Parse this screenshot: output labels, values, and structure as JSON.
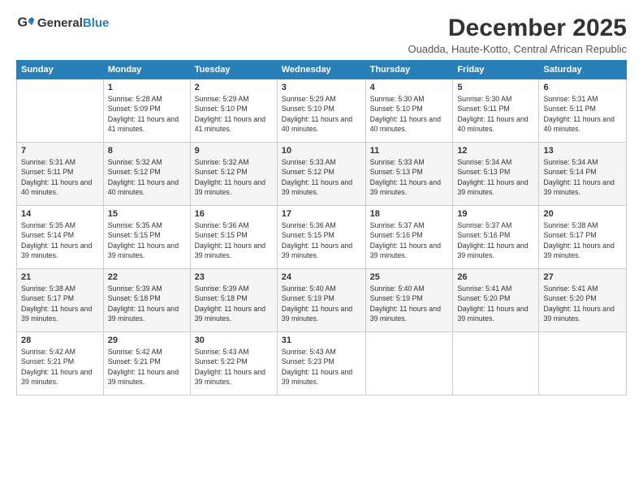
{
  "logo": {
    "general": "General",
    "blue": "Blue"
  },
  "title": "December 2025",
  "location": "Ouadda, Haute-Kotto, Central African Republic",
  "weekdays": [
    "Sunday",
    "Monday",
    "Tuesday",
    "Wednesday",
    "Thursday",
    "Friday",
    "Saturday"
  ],
  "weeks": [
    [
      {
        "day": "",
        "sunrise": "",
        "sunset": "",
        "daylight": ""
      },
      {
        "day": "1",
        "sunrise": "Sunrise: 5:28 AM",
        "sunset": "Sunset: 5:09 PM",
        "daylight": "Daylight: 11 hours and 41 minutes."
      },
      {
        "day": "2",
        "sunrise": "Sunrise: 5:29 AM",
        "sunset": "Sunset: 5:10 PM",
        "daylight": "Daylight: 11 hours and 41 minutes."
      },
      {
        "day": "3",
        "sunrise": "Sunrise: 5:29 AM",
        "sunset": "Sunset: 5:10 PM",
        "daylight": "Daylight: 11 hours and 40 minutes."
      },
      {
        "day": "4",
        "sunrise": "Sunrise: 5:30 AM",
        "sunset": "Sunset: 5:10 PM",
        "daylight": "Daylight: 11 hours and 40 minutes."
      },
      {
        "day": "5",
        "sunrise": "Sunrise: 5:30 AM",
        "sunset": "Sunset: 5:11 PM",
        "daylight": "Daylight: 11 hours and 40 minutes."
      },
      {
        "day": "6",
        "sunrise": "Sunrise: 5:31 AM",
        "sunset": "Sunset: 5:11 PM",
        "daylight": "Daylight: 11 hours and 40 minutes."
      }
    ],
    [
      {
        "day": "7",
        "sunrise": "Sunrise: 5:31 AM",
        "sunset": "Sunset: 5:11 PM",
        "daylight": "Daylight: 11 hours and 40 minutes."
      },
      {
        "day": "8",
        "sunrise": "Sunrise: 5:32 AM",
        "sunset": "Sunset: 5:12 PM",
        "daylight": "Daylight: 11 hours and 40 minutes."
      },
      {
        "day": "9",
        "sunrise": "Sunrise: 5:32 AM",
        "sunset": "Sunset: 5:12 PM",
        "daylight": "Daylight: 11 hours and 39 minutes."
      },
      {
        "day": "10",
        "sunrise": "Sunrise: 5:33 AM",
        "sunset": "Sunset: 5:12 PM",
        "daylight": "Daylight: 11 hours and 39 minutes."
      },
      {
        "day": "11",
        "sunrise": "Sunrise: 5:33 AM",
        "sunset": "Sunset: 5:13 PM",
        "daylight": "Daylight: 11 hours and 39 minutes."
      },
      {
        "day": "12",
        "sunrise": "Sunrise: 5:34 AM",
        "sunset": "Sunset: 5:13 PM",
        "daylight": "Daylight: 11 hours and 39 minutes."
      },
      {
        "day": "13",
        "sunrise": "Sunrise: 5:34 AM",
        "sunset": "Sunset: 5:14 PM",
        "daylight": "Daylight: 11 hours and 39 minutes."
      }
    ],
    [
      {
        "day": "14",
        "sunrise": "Sunrise: 5:35 AM",
        "sunset": "Sunset: 5:14 PM",
        "daylight": "Daylight: 11 hours and 39 minutes."
      },
      {
        "day": "15",
        "sunrise": "Sunrise: 5:35 AM",
        "sunset": "Sunset: 5:15 PM",
        "daylight": "Daylight: 11 hours and 39 minutes."
      },
      {
        "day": "16",
        "sunrise": "Sunrise: 5:36 AM",
        "sunset": "Sunset: 5:15 PM",
        "daylight": "Daylight: 11 hours and 39 minutes."
      },
      {
        "day": "17",
        "sunrise": "Sunrise: 5:36 AM",
        "sunset": "Sunset: 5:15 PM",
        "daylight": "Daylight: 11 hours and 39 minutes."
      },
      {
        "day": "18",
        "sunrise": "Sunrise: 5:37 AM",
        "sunset": "Sunset: 5:16 PM",
        "daylight": "Daylight: 11 hours and 39 minutes."
      },
      {
        "day": "19",
        "sunrise": "Sunrise: 5:37 AM",
        "sunset": "Sunset: 5:16 PM",
        "daylight": "Daylight: 11 hours and 39 minutes."
      },
      {
        "day": "20",
        "sunrise": "Sunrise: 5:38 AM",
        "sunset": "Sunset: 5:17 PM",
        "daylight": "Daylight: 11 hours and 39 minutes."
      }
    ],
    [
      {
        "day": "21",
        "sunrise": "Sunrise: 5:38 AM",
        "sunset": "Sunset: 5:17 PM",
        "daylight": "Daylight: 11 hours and 39 minutes."
      },
      {
        "day": "22",
        "sunrise": "Sunrise: 5:39 AM",
        "sunset": "Sunset: 5:18 PM",
        "daylight": "Daylight: 11 hours and 39 minutes."
      },
      {
        "day": "23",
        "sunrise": "Sunrise: 5:39 AM",
        "sunset": "Sunset: 5:18 PM",
        "daylight": "Daylight: 11 hours and 39 minutes."
      },
      {
        "day": "24",
        "sunrise": "Sunrise: 5:40 AM",
        "sunset": "Sunset: 5:19 PM",
        "daylight": "Daylight: 11 hours and 39 minutes."
      },
      {
        "day": "25",
        "sunrise": "Sunrise: 5:40 AM",
        "sunset": "Sunset: 5:19 PM",
        "daylight": "Daylight: 11 hours and 39 minutes."
      },
      {
        "day": "26",
        "sunrise": "Sunrise: 5:41 AM",
        "sunset": "Sunset: 5:20 PM",
        "daylight": "Daylight: 11 hours and 39 minutes."
      },
      {
        "day": "27",
        "sunrise": "Sunrise: 5:41 AM",
        "sunset": "Sunset: 5:20 PM",
        "daylight": "Daylight: 11 hours and 39 minutes."
      }
    ],
    [
      {
        "day": "28",
        "sunrise": "Sunrise: 5:42 AM",
        "sunset": "Sunset: 5:21 PM",
        "daylight": "Daylight: 11 hours and 39 minutes."
      },
      {
        "day": "29",
        "sunrise": "Sunrise: 5:42 AM",
        "sunset": "Sunset: 5:21 PM",
        "daylight": "Daylight: 11 hours and 39 minutes."
      },
      {
        "day": "30",
        "sunrise": "Sunrise: 5:43 AM",
        "sunset": "Sunset: 5:22 PM",
        "daylight": "Daylight: 11 hours and 39 minutes."
      },
      {
        "day": "31",
        "sunrise": "Sunrise: 5:43 AM",
        "sunset": "Sunset: 5:23 PM",
        "daylight": "Daylight: 11 hours and 39 minutes."
      },
      {
        "day": "",
        "sunrise": "",
        "sunset": "",
        "daylight": ""
      },
      {
        "day": "",
        "sunrise": "",
        "sunset": "",
        "daylight": ""
      },
      {
        "day": "",
        "sunrise": "",
        "sunset": "",
        "daylight": ""
      }
    ]
  ]
}
